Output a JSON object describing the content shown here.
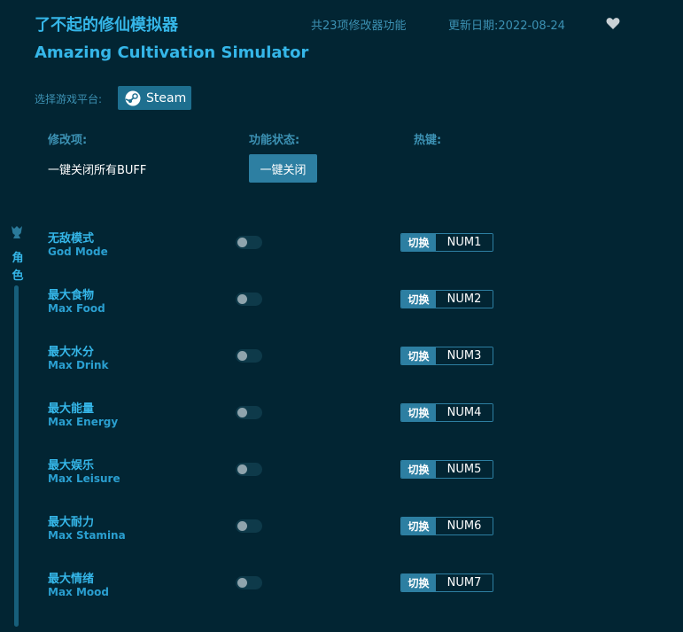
{
  "header": {
    "title_cn": "了不起的修仙模拟器",
    "title_en": "Amazing Cultivation Simulator",
    "feature_count": "共23项修改器功能",
    "update_date": "更新日期:2022-08-24"
  },
  "platform": {
    "label": "选择游戏平台:",
    "steam_label": "Steam"
  },
  "columns": {
    "mod": "修改项:",
    "status": "功能状态:",
    "hotkey": "热键:"
  },
  "buff": {
    "label": "一键关闭所有BUFF",
    "button": "一键关闭"
  },
  "sidebar": {
    "char1": "角",
    "char2": "色"
  },
  "colors": {
    "background": "#022533",
    "accent": "#35b6e8",
    "button": "#2d7fa2"
  },
  "rows": [
    {
      "cn": "无敌模式",
      "en": "God Mode",
      "toggle": "切换",
      "key": "NUM1"
    },
    {
      "cn": "最大食物",
      "en": "Max Food",
      "toggle": "切换",
      "key": "NUM2"
    },
    {
      "cn": "最大水分",
      "en": "Max Drink",
      "toggle": "切换",
      "key": "NUM3"
    },
    {
      "cn": "最大能量",
      "en": "Max Energy",
      "toggle": "切换",
      "key": "NUM4"
    },
    {
      "cn": "最大娱乐",
      "en": "Max Leisure",
      "toggle": "切换",
      "key": "NUM5"
    },
    {
      "cn": "最大耐力",
      "en": "Max Stamina",
      "toggle": "切换",
      "key": "NUM6"
    },
    {
      "cn": "最大情绪",
      "en": "Max Mood",
      "toggle": "切换",
      "key": "NUM7"
    }
  ]
}
